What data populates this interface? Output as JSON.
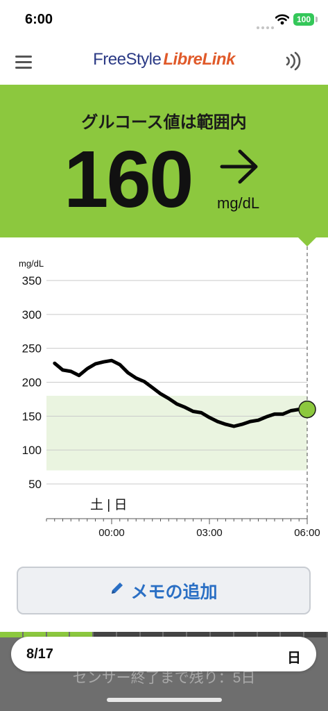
{
  "status_bar": {
    "time": "6:00",
    "battery": "100"
  },
  "header": {
    "logo_part1": "FreeStyle",
    "logo_part2": "LibreLink",
    "menu_icon": "hamburger-menu-icon",
    "sensor_icon": "nfc-scan-icon"
  },
  "glucose": {
    "status": "グルコース値は範囲内",
    "value": "160",
    "unit": "mg/dL",
    "trend": "right-arrow-icon"
  },
  "chart_data": {
    "type": "line",
    "ylabel": "mg/dL",
    "yticks": [
      350,
      300,
      250,
      200,
      150,
      100,
      50
    ],
    "xticks": [
      "00:00",
      "03:00",
      "06:00"
    ],
    "day_label": "土 | 日",
    "target_range": [
      70,
      180
    ],
    "ylim": [
      50,
      350
    ],
    "x": [
      "22:15",
      "22:30",
      "22:45",
      "23:00",
      "23:15",
      "23:30",
      "23:45",
      "00:00",
      "00:15",
      "00:30",
      "00:45",
      "01:00",
      "01:15",
      "01:30",
      "01:45",
      "02:00",
      "02:15",
      "02:30",
      "02:45",
      "03:00",
      "03:15",
      "03:30",
      "03:45",
      "04:00",
      "04:15",
      "04:30",
      "04:45",
      "05:00",
      "05:15",
      "05:30",
      "05:45",
      "06:00"
    ],
    "values": [
      228,
      218,
      216,
      210,
      220,
      227,
      230,
      232,
      226,
      214,
      206,
      201,
      192,
      183,
      176,
      168,
      163,
      157,
      155,
      148,
      142,
      138,
      135,
      138,
      142,
      144,
      149,
      153,
      153,
      158,
      160,
      160
    ],
    "current_point": {
      "x": "06:00",
      "value": 160
    },
    "colors": {
      "line": "#000000",
      "range_fill": "#eaf4e0",
      "point": "#8cc83e"
    }
  },
  "actions": {
    "add_note": "メモの追加"
  },
  "bottom": {
    "date": "8/17",
    "day": "日",
    "sensor_remaining": "センサー終了まで残り：5日",
    "sensor_days_used": 4,
    "sensor_days_total": 14
  },
  "colors": {
    "accent_green": "#8cc83e",
    "note_blue": "#2a6fc4",
    "logo_blue": "#2b3a85",
    "logo_orange": "#e05a2a"
  }
}
